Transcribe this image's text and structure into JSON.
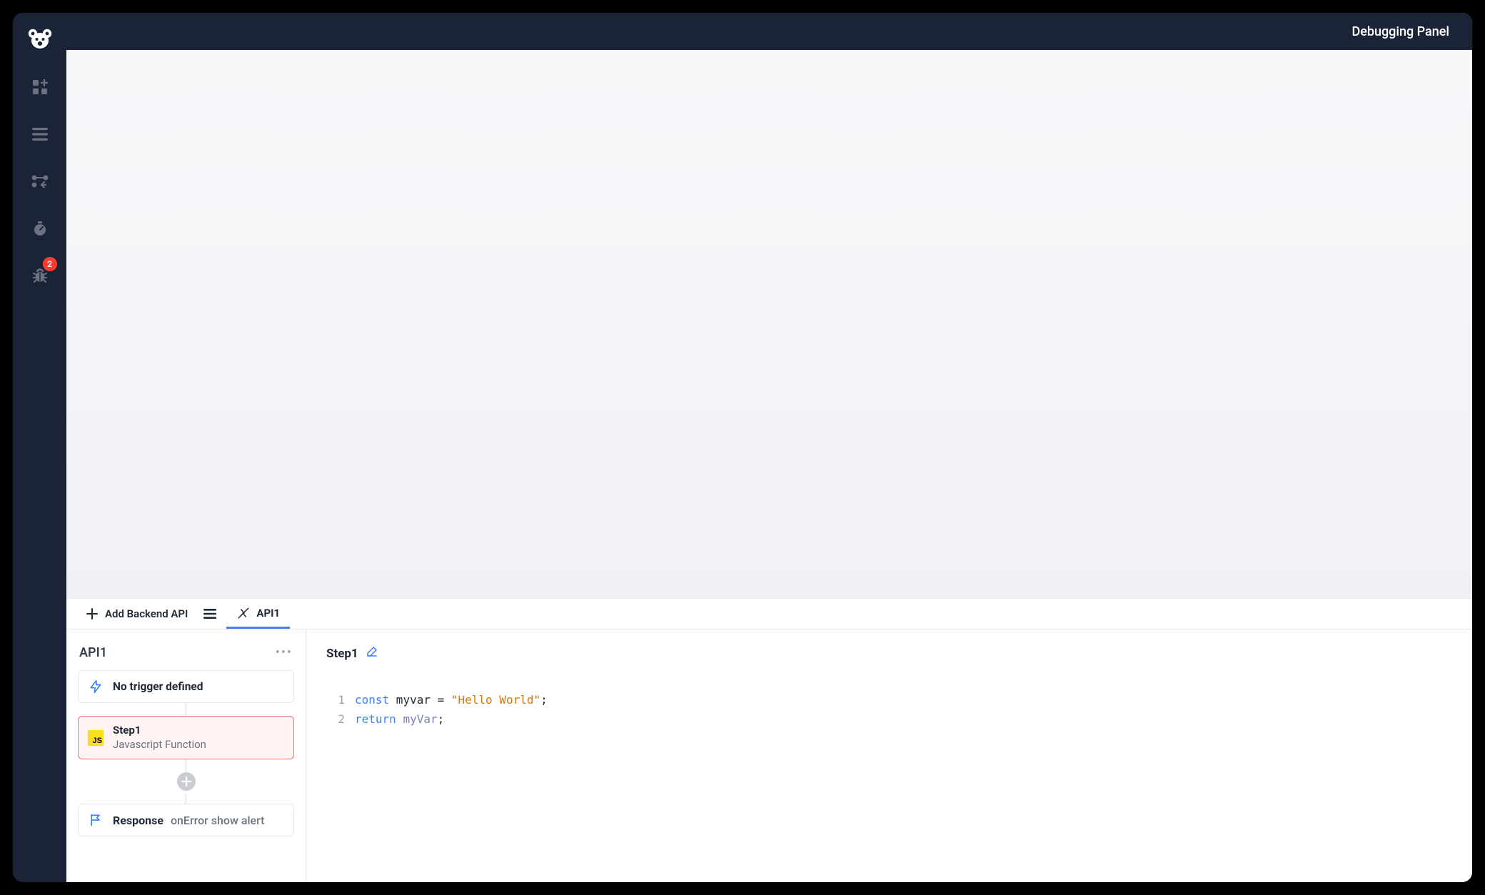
{
  "header": {
    "title": "Debugging Panel"
  },
  "rail": {
    "badge_count": "2"
  },
  "tabs": {
    "add_label": "Add Backend API",
    "api_label": "API1"
  },
  "api_panel": {
    "title": "API1",
    "trigger": {
      "label": "No trigger defined"
    },
    "step": {
      "title": "Step1",
      "subtitle": "Javascript Function"
    },
    "response": {
      "label": "Response",
      "detail": "onError show alert"
    }
  },
  "editor": {
    "step_title": "Step1",
    "lines": [
      [
        {
          "t": "kw",
          "v": "const"
        },
        {
          "t": "plain",
          "v": " myvar "
        },
        {
          "t": "plain",
          "v": "= "
        },
        {
          "t": "str",
          "v": "\"Hello World\""
        },
        {
          "t": "plain",
          "v": ";"
        }
      ],
      [
        {
          "t": "kw",
          "v": "return"
        },
        {
          "t": "plain",
          "v": " "
        },
        {
          "t": "id2",
          "v": "myVar"
        },
        {
          "t": "plain",
          "v": ";"
        }
      ]
    ]
  }
}
